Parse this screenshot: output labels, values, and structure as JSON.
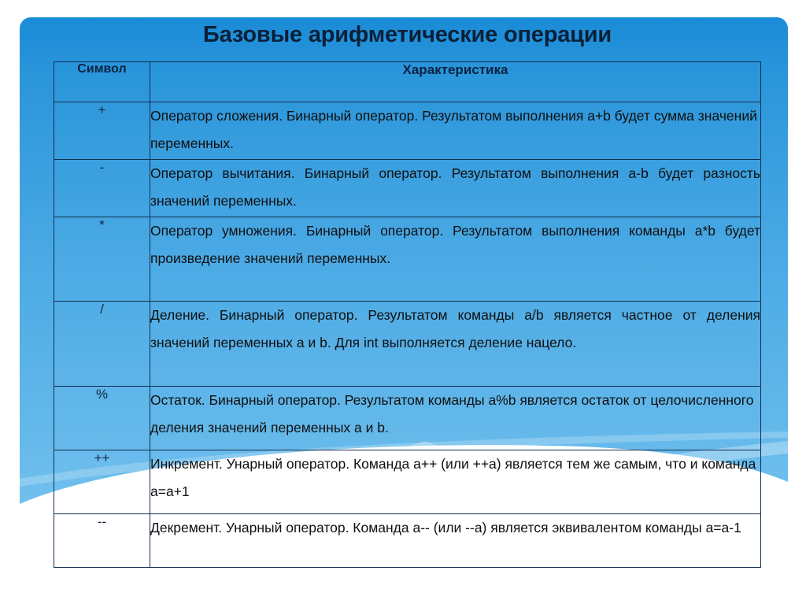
{
  "slide": {
    "title": "Базовые арифметические операции",
    "accent_color": "#1a8bd8",
    "panel_gradient_top": "#1a8bd8",
    "panel_gradient_bottom": "#7cc6f1",
    "text_color": "#0a2038"
  },
  "table": {
    "headers": {
      "symbol": "Символ",
      "description": "Характеристика"
    },
    "rows": [
      {
        "symbol": "+",
        "description": "Оператор сложения. Бинарный оператор. Результатом выполнения a+b будет сумма значений переменных.",
        "cell_background": "blue"
      },
      {
        "symbol": "-",
        "description": "Оператор вычитания. Бинарный оператор. Результатом выполнения a-b будет разность значений переменных.",
        "cell_background": "blue"
      },
      {
        "symbol": "*",
        "description": "Оператор умножения. Бинарный оператор. Результатом выполнения команды a*b будет произведение значений переменных.",
        "cell_background": "blue"
      },
      {
        "symbol": "/",
        "description": "Деление. Бинарный оператор. Результатом команды a/b является частное от деления значений переменных a и b. Для int выполняется деление нацело.",
        "cell_background": "white"
      },
      {
        "symbol": "%",
        "description": "Остаток. Бинарный оператор. Результатом команды a%b является остаток от целочисленного деления значений переменных a и b.",
        "cell_background": "blue"
      },
      {
        "symbol": "++",
        "description": "Инкремент. Унарный оператор. Команда a++ (или ++a) является тем же самым, что и  команда a=a+1",
        "cell_background": "blue"
      },
      {
        "symbol": "--",
        "description": "Декремент. Унарный оператор. Команда a-- (или --a) является эквивалентом команды a=a-1",
        "cell_background": "white"
      }
    ]
  }
}
